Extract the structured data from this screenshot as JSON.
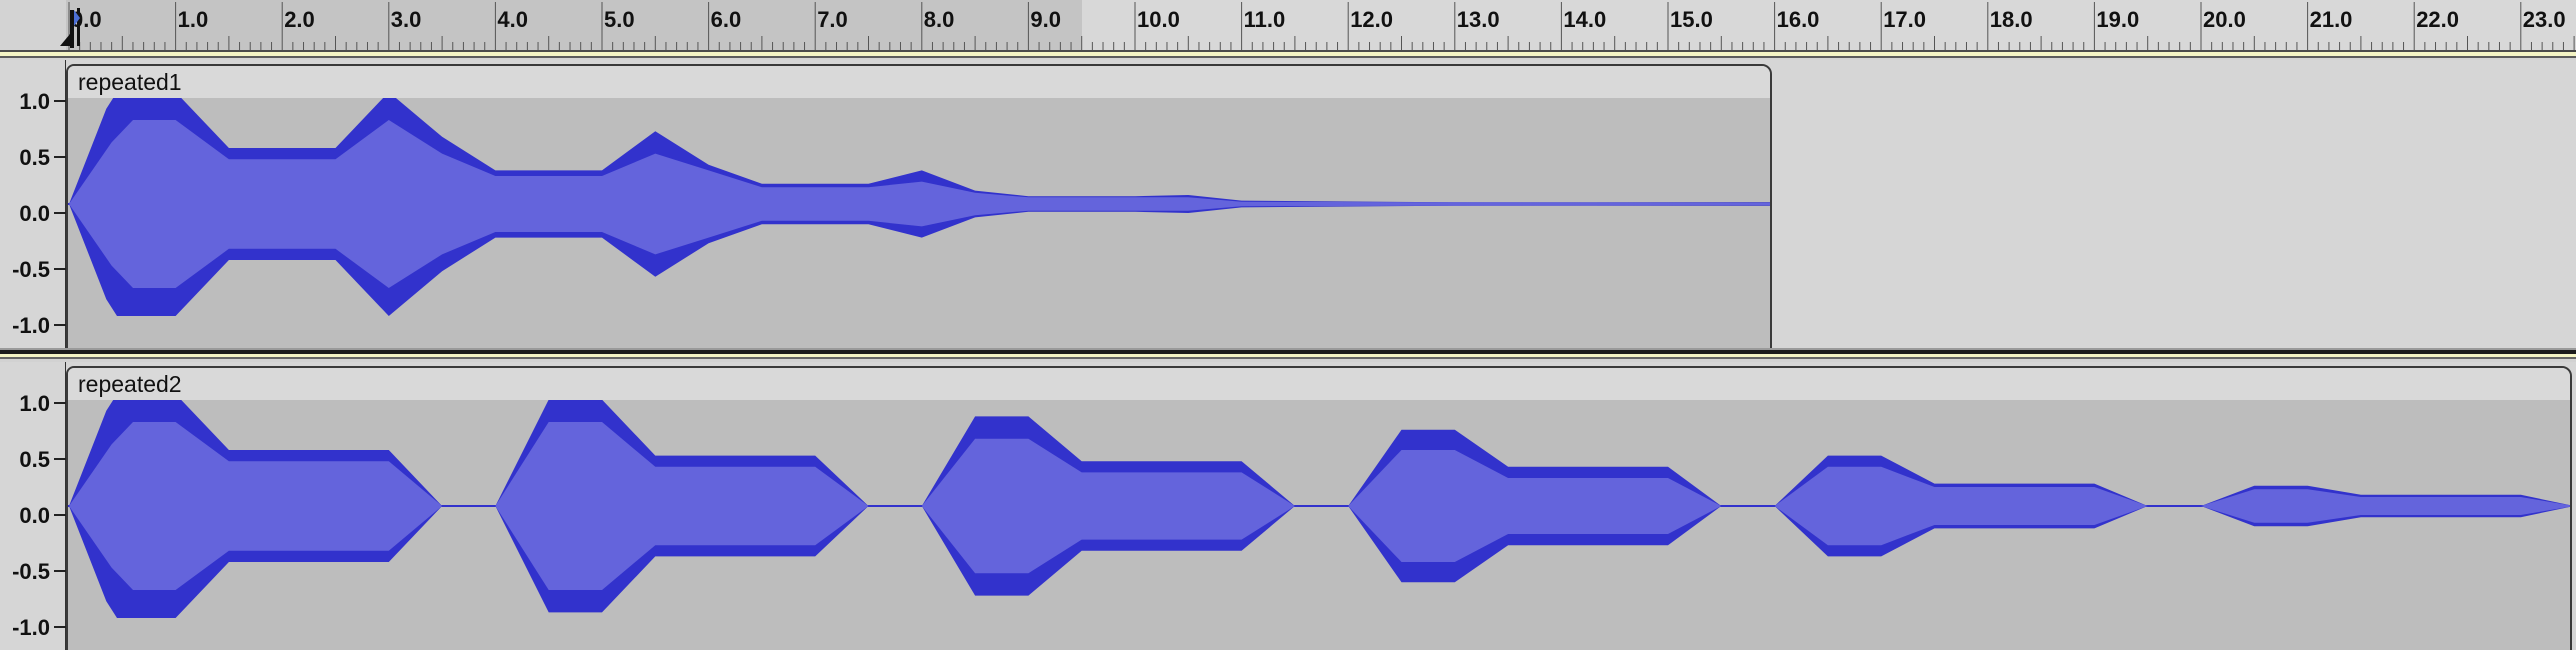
{
  "ruler": {
    "unit": "seconds",
    "tick_labels": [
      "0.0",
      "1.0",
      "2.0",
      "3.0",
      "4.0",
      "5.0",
      "6.0",
      "7.0",
      "8.0",
      "9.0",
      "10.0",
      "11.0",
      "12.0",
      "13.0",
      "14.0",
      "15.0",
      "16.0",
      "17.0",
      "18.0",
      "19.0",
      "20.0",
      "21.0",
      "22.0",
      "23.0"
    ],
    "playhead_time": 0.0
  },
  "tracks": [
    {
      "clip_name": "repeated1",
      "clip_end_time": 16.0,
      "amplitude_labels": [
        "1.0",
        "0.5",
        "0.0",
        "-0.5",
        "-1.0"
      ],
      "peak_envelope": [
        [
          0.0,
          0.0
        ],
        [
          0.35,
          0.85
        ],
        [
          0.45,
          1.0
        ],
        [
          1.0,
          1.0
        ],
        [
          1.5,
          0.5
        ],
        [
          2.5,
          0.5
        ],
        [
          3.0,
          1.0
        ],
        [
          3.5,
          0.6
        ],
        [
          4.0,
          0.3
        ],
        [
          5.0,
          0.3
        ],
        [
          5.5,
          0.65
        ],
        [
          6.0,
          0.35
        ],
        [
          6.5,
          0.18
        ],
        [
          7.5,
          0.18
        ],
        [
          8.0,
          0.3
        ],
        [
          8.5,
          0.12
        ],
        [
          9.0,
          0.07
        ],
        [
          10.0,
          0.07
        ],
        [
          10.5,
          0.08
        ],
        [
          11.0,
          0.03
        ],
        [
          13.0,
          0.015
        ],
        [
          16.0,
          0.015
        ]
      ],
      "rms_envelope": [
        [
          0.0,
          0.0
        ],
        [
          0.4,
          0.55
        ],
        [
          0.6,
          0.75
        ],
        [
          1.0,
          0.75
        ],
        [
          1.5,
          0.4
        ],
        [
          2.5,
          0.4
        ],
        [
          3.0,
          0.75
        ],
        [
          3.5,
          0.45
        ],
        [
          4.0,
          0.25
        ],
        [
          5.0,
          0.25
        ],
        [
          5.5,
          0.45
        ],
        [
          6.0,
          0.3
        ],
        [
          6.5,
          0.15
        ],
        [
          7.5,
          0.15
        ],
        [
          8.0,
          0.2
        ],
        [
          8.5,
          0.1
        ],
        [
          9.0,
          0.06
        ],
        [
          10.0,
          0.06
        ],
        [
          10.5,
          0.06
        ],
        [
          11.0,
          0.02
        ],
        [
          16.0,
          0.01
        ]
      ]
    },
    {
      "clip_name": "repeated2",
      "clip_end_time": 23.5,
      "amplitude_labels": [
        "1.0",
        "0.5",
        "0.0",
        "-0.5",
        "-1.0"
      ],
      "peak_envelope": [
        [
          0.0,
          0.0
        ],
        [
          0.35,
          0.85
        ],
        [
          0.45,
          1.0
        ],
        [
          1.0,
          1.0
        ],
        [
          1.5,
          0.5
        ],
        [
          3.0,
          0.5
        ],
        [
          3.5,
          0.0
        ],
        [
          4.0,
          0.0
        ],
        [
          4.5,
          0.95
        ],
        [
          5.0,
          0.95
        ],
        [
          5.5,
          0.45
        ],
        [
          7.0,
          0.45
        ],
        [
          7.5,
          0.0
        ],
        [
          8.0,
          0.0
        ],
        [
          8.5,
          0.8
        ],
        [
          9.0,
          0.8
        ],
        [
          9.5,
          0.4
        ],
        [
          11.0,
          0.4
        ],
        [
          11.5,
          0.0
        ],
        [
          12.0,
          0.0
        ],
        [
          12.5,
          0.68
        ],
        [
          13.0,
          0.68
        ],
        [
          13.5,
          0.35
        ],
        [
          15.0,
          0.35
        ],
        [
          15.5,
          0.0
        ],
        [
          16.0,
          0.0
        ],
        [
          16.5,
          0.45
        ],
        [
          17.0,
          0.45
        ],
        [
          17.5,
          0.2
        ],
        [
          19.0,
          0.2
        ],
        [
          19.5,
          0.0
        ],
        [
          20.0,
          0.0
        ],
        [
          20.5,
          0.18
        ],
        [
          21.0,
          0.18
        ],
        [
          21.5,
          0.1
        ],
        [
          23.0,
          0.1
        ],
        [
          23.5,
          0.0
        ]
      ],
      "rms_envelope": [
        [
          0.0,
          0.0
        ],
        [
          0.4,
          0.55
        ],
        [
          0.6,
          0.75
        ],
        [
          1.0,
          0.75
        ],
        [
          1.5,
          0.4
        ],
        [
          3.0,
          0.4
        ],
        [
          3.5,
          0.0
        ],
        [
          4.0,
          0.0
        ],
        [
          4.5,
          0.75
        ],
        [
          5.0,
          0.75
        ],
        [
          5.5,
          0.35
        ],
        [
          7.0,
          0.35
        ],
        [
          7.5,
          0.0
        ],
        [
          8.0,
          0.0
        ],
        [
          8.5,
          0.6
        ],
        [
          9.0,
          0.6
        ],
        [
          9.5,
          0.3
        ],
        [
          11.0,
          0.3
        ],
        [
          11.5,
          0.0
        ],
        [
          12.0,
          0.0
        ],
        [
          12.5,
          0.5
        ],
        [
          13.0,
          0.5
        ],
        [
          13.5,
          0.25
        ],
        [
          15.0,
          0.25
        ],
        [
          15.5,
          0.0
        ],
        [
          16.0,
          0.0
        ],
        [
          16.5,
          0.35
        ],
        [
          17.0,
          0.35
        ],
        [
          17.5,
          0.17
        ],
        [
          19.0,
          0.17
        ],
        [
          19.5,
          0.0
        ],
        [
          20.0,
          0.0
        ],
        [
          20.5,
          0.15
        ],
        [
          21.0,
          0.15
        ],
        [
          21.5,
          0.08
        ],
        [
          23.0,
          0.08
        ],
        [
          23.5,
          0.0
        ]
      ]
    }
  ],
  "colors": {
    "waveform_peak": "#3232cc",
    "waveform_rms": "#6464dc",
    "clip_background": "#bdbdbd",
    "clip_header": "#d9d9d9",
    "track_background": "#d6d6d6",
    "ruler_played": "#c4c4c4"
  }
}
